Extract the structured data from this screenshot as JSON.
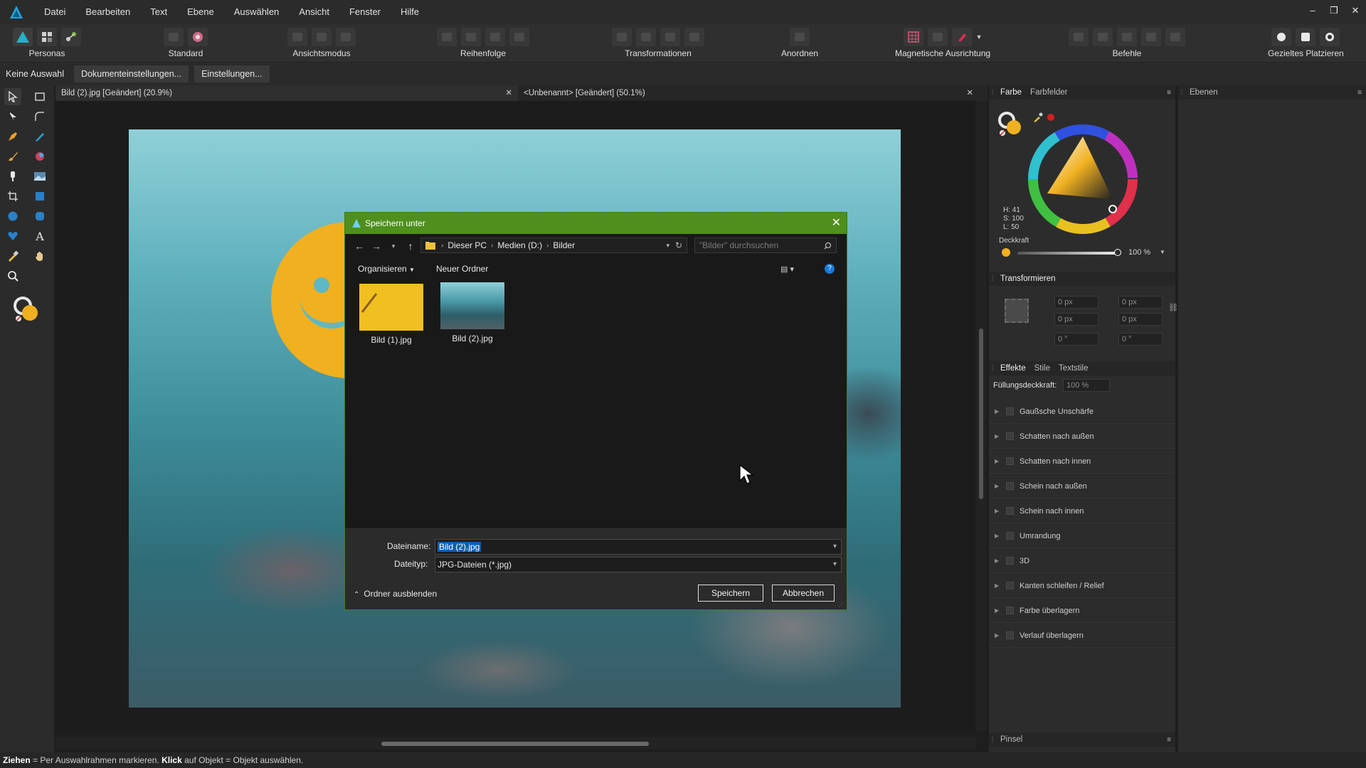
{
  "menubar": {
    "items": [
      "Datei",
      "Bearbeiten",
      "Text",
      "Ebene",
      "Auswählen",
      "Ansicht",
      "Fenster",
      "Hilfe"
    ],
    "window_controls": [
      "–",
      "❐",
      "✕"
    ]
  },
  "toolbar": {
    "groups": [
      "Personas",
      "Standard",
      "Ansichtsmodus",
      "Reihenfolge",
      "Transformationen",
      "Anordnen",
      "Magnetische Ausrichtung",
      "Befehle",
      "Gezieltes Platzieren"
    ]
  },
  "context_bar": {
    "selection": "Keine Auswahl",
    "doc_settings": "Dokumenteinstellungen...",
    "settings": "Einstellungen..."
  },
  "tabs": [
    {
      "label": "Bild (2).jpg [Geändert] (20.9%)"
    },
    {
      "label": "<Unbenannt> [Geändert] (50.1%)"
    }
  ],
  "color_panel": {
    "tabs": [
      "Farbe",
      "Farbfelder"
    ],
    "hsl": {
      "h": "H: 41",
      "s": "S: 100",
      "l": "L: 50"
    },
    "opacity_label": "Deckkraft",
    "opacity_value": "100 %",
    "swatch_color": "#f0b020"
  },
  "layers_panel": {
    "title": "Ebenen"
  },
  "transform_panel": {
    "title": "Transformieren",
    "fields": [
      "0 px",
      "0 px",
      "0 px",
      "0 px",
      "0 °",
      "0 °"
    ]
  },
  "effects_panel": {
    "tabs": [
      "Effekte",
      "Stile",
      "Textstile"
    ],
    "fill_opacity_label": "Füllungsdeckkraft:",
    "fill_opacity_value": "100 %",
    "effects": [
      "Gaußsche Unschärfe",
      "Schatten nach außen",
      "Schatten nach innen",
      "Schein nach außen",
      "Schein nach innen",
      "Umrandung",
      "3D",
      "Kanten schleifen / Relief",
      "Farbe überlagern",
      "Verlauf überlagern"
    ]
  },
  "brush_panel": {
    "title": "Pinsel"
  },
  "status": {
    "drag_bold": "Ziehen",
    "drag_text": " = Per Auswahlrahmen markieren. ",
    "click_bold": "Klick",
    "click_text": " auf Objekt = Objekt auswählen."
  },
  "dialog": {
    "title": "Speichern unter",
    "breadcrumb": [
      "Dieser PC",
      "Medien (D:)",
      "Bilder"
    ],
    "search_placeholder": "\"Bilder\" durchsuchen",
    "organize": "Organisieren",
    "new_folder": "Neuer Ordner",
    "files": [
      {
        "name": "Bild (1).jpg"
      },
      {
        "name": "Bild (2).jpg"
      }
    ],
    "filename_label": "Dateiname:",
    "filename_value": "Bild (2).jpg",
    "filetype_label": "Dateityp:",
    "filetype_value": "JPG-Dateien (*.jpg)",
    "hide_folders": "Ordner ausblenden",
    "save_button": "Speichern",
    "cancel_button": "Abbrechen",
    "accent_color": "#4f8f1d"
  }
}
